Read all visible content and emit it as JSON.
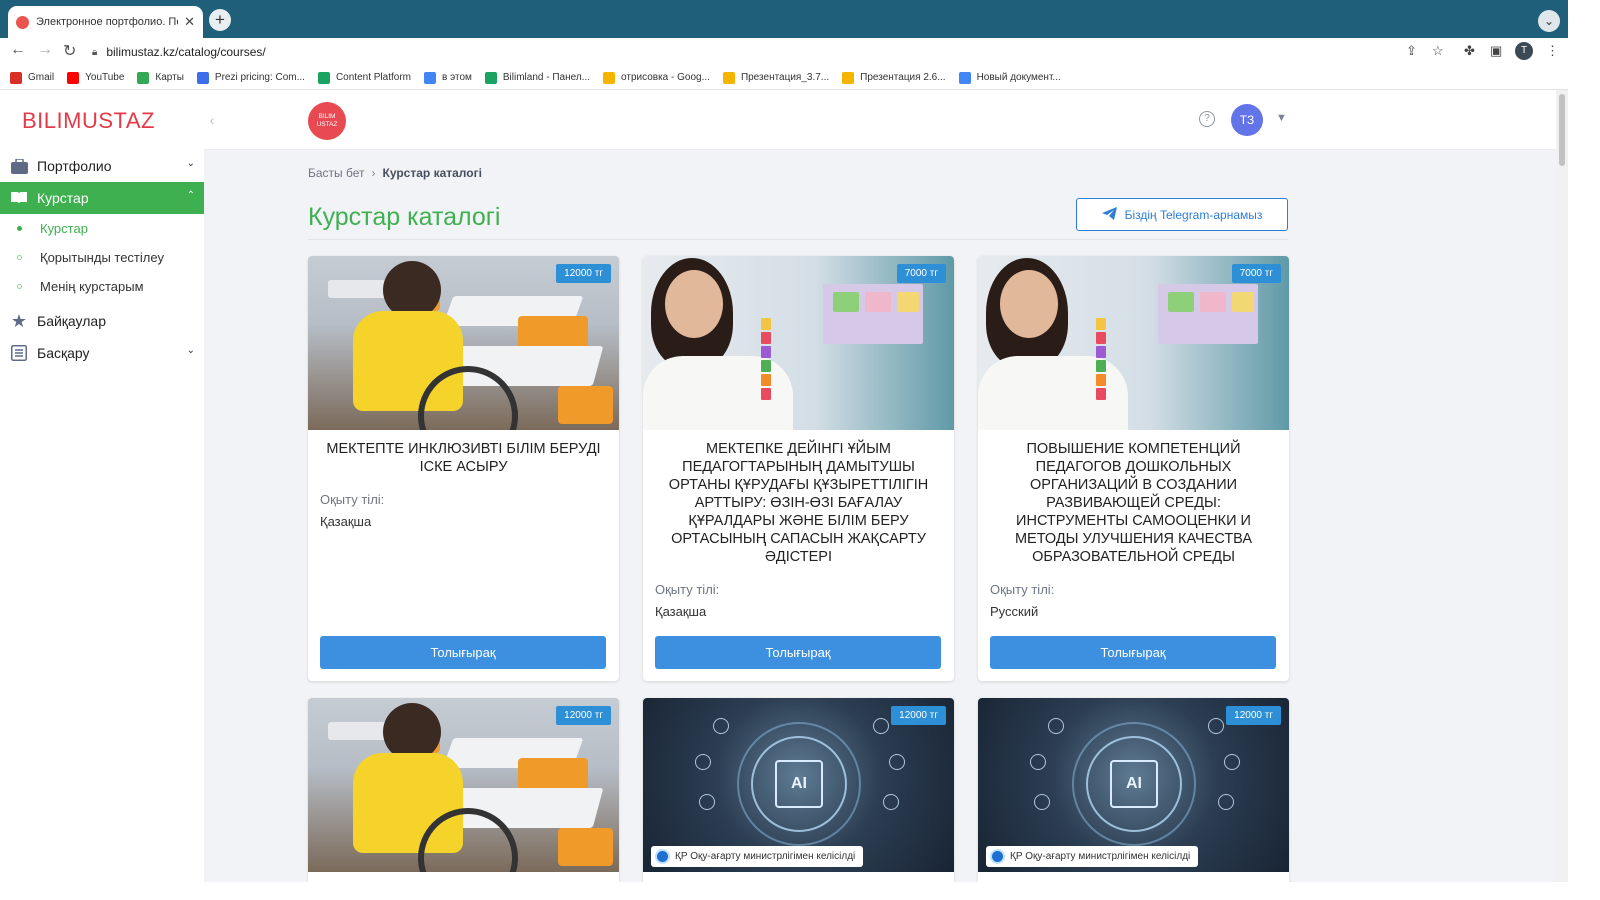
{
  "browser": {
    "tab_title": "Электронное портфолио. Под",
    "url": "bilimustaz.kz/catalog/courses/",
    "profile_initial": "T",
    "bookmarks": [
      {
        "label": "Gmail",
        "color": "#d93025"
      },
      {
        "label": "YouTube",
        "color": "#ff0000"
      },
      {
        "label": "Карты",
        "color": "#34a853"
      },
      {
        "label": "Prezi pricing: Com...",
        "color": "#3b6ee8"
      },
      {
        "label": "Content Platform",
        "color": "#1aa260"
      },
      {
        "label": "в этом",
        "color": "#4285f4"
      },
      {
        "label": "Bilimland - Панел...",
        "color": "#1aa260"
      },
      {
        "label": "отрисовка - Goog...",
        "color": "#f4b400"
      },
      {
        "label": "Презентация_3.7...",
        "color": "#f4b400"
      },
      {
        "label": "Презентация 2.6...",
        "color": "#f4b400"
      },
      {
        "label": "Новый документ...",
        "color": "#4285f4"
      }
    ]
  },
  "sidebar": {
    "logo": "BILIMUSTAZ",
    "items": [
      {
        "label": "Портфолио",
        "icon": "briefcase-icon"
      },
      {
        "label": "Курстар",
        "icon": "book-icon"
      },
      {
        "label": "Байқаулар",
        "icon": "star-icon"
      },
      {
        "label": "Басқару",
        "icon": "list-icon"
      }
    ],
    "subitems": [
      "Курстар",
      "Қорытынды тестілеу",
      "Менің курстарым"
    ]
  },
  "header": {
    "badge_line1": "BILIM",
    "badge_line2": "USTAZ",
    "avatar_initials": "ТЗ",
    "help": "?"
  },
  "breadcrumb": {
    "home": "Басты бет",
    "current": "Курстар каталогі"
  },
  "page": {
    "title": "Курстар каталогі",
    "telegram_button": "Біздің Telegram-арнамыз"
  },
  "cards": [
    {
      "price": "12000 тг",
      "title": "Мектепте инклюзивті білім беруді іске асыру",
      "lang_label": "Оқыту тілі:",
      "lang": "Қазақша",
      "button": "Толығырақ"
    },
    {
      "price": "7000 тг",
      "title": "Мектепке дейінгі ұйым педагогтарының дамытушы ортаны құрудағы құзыреттілігін арттыру: өзін-өзі бағалау құралдары және білім беру ортасының сапасын жақсарту әдістері",
      "lang_label": "Оқыту тілі:",
      "lang": "Қазақша",
      "button": "Толығырақ"
    },
    {
      "price": "7000 тг",
      "title": "Повышение компетенций педагогов дошкольных организаций в создании развивающей среды: инструменты самооценки и методы улучшения качества образовательной среды",
      "lang_label": "Оқыту тілі:",
      "lang": "Русский",
      "button": "Толығырақ"
    },
    {
      "price": "12000 тг"
    },
    {
      "price": "12000 тг",
      "ministry": "ҚР Оқу-ағарту министрлігімен келісілді"
    },
    {
      "price": "12000 тг",
      "ministry": "ҚР Оқу-ағарту министрлігімен келісілді"
    }
  ]
}
